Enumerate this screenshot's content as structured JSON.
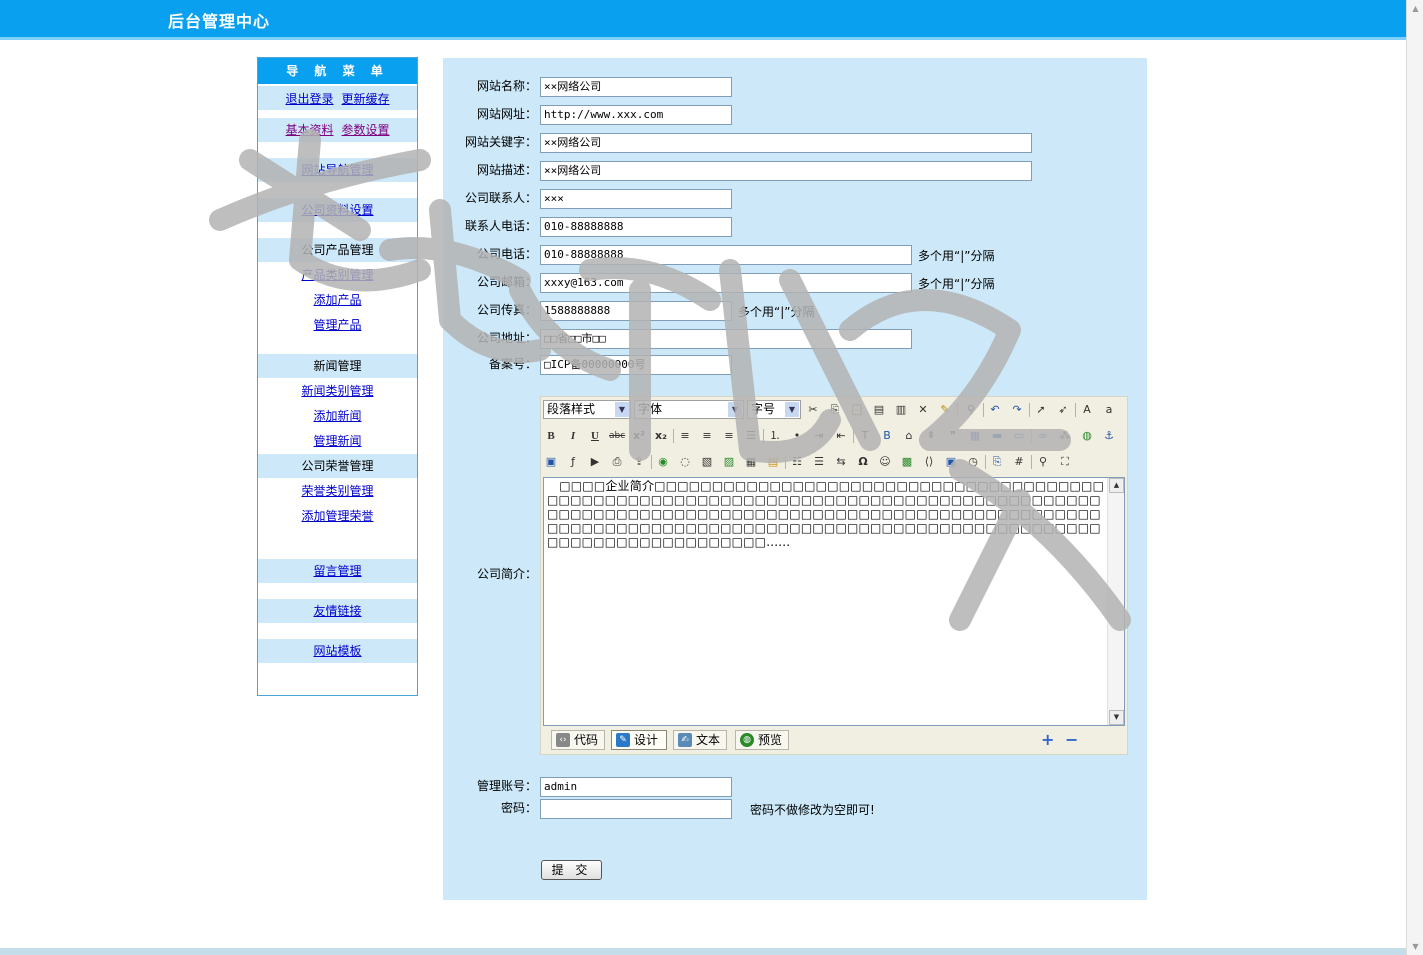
{
  "header": {
    "title": "后台管理中心"
  },
  "sidebar": {
    "heading": "导 航 菜 单",
    "logout": "退出登录",
    "refresh_cache": "更新缓存",
    "basic_info": "基本资料",
    "params": "参数设置",
    "site_nav": "网站导航管理",
    "company_info": "公司资料设置",
    "product_section": "公司产品管理",
    "product_category": "产品类别管理",
    "add_product": "添加产品",
    "manage_product": "管理产品",
    "news_section": "新闻管理",
    "news_category": "新闻类别管理",
    "add_news": "添加新闻",
    "manage_news": "管理新闻",
    "honor_section": "公司荣誉管理",
    "honor_category": "荣誉类别管理",
    "add_honor": "添加管理荣誉",
    "guestbook": "留言管理",
    "links": "友情链接",
    "template": "网站模板"
  },
  "form": {
    "site_name": {
      "label": "网站名称：",
      "value": "××网络公司"
    },
    "site_url": {
      "label": "网站网址：",
      "value": "http://www.xxx.com"
    },
    "keywords": {
      "label": "网站关键字：",
      "value": "××网络公司"
    },
    "description": {
      "label": "网站描述：",
      "value": "××网络公司"
    },
    "contact": {
      "label": "公司联系人：",
      "value": "×××"
    },
    "contact_phone": {
      "label": "联系人电话：",
      "value": "010-88888888"
    },
    "company_phone": {
      "label": "公司电话：",
      "value": "010-88888888",
      "hint": "多个用“|”分隔"
    },
    "company_email": {
      "label": "公司邮箱：",
      "value": "xxxy@163.com",
      "hint": "多个用“|”分隔"
    },
    "company_fax": {
      "label": "公司传真：",
      "value": "1588888888",
      "hint": "多个用“|”分隔"
    },
    "company_address": {
      "label": "公司地址：",
      "value": "□□省□□市□□"
    },
    "icp": {
      "label": "备案号：",
      "value": "□ICP备00000000号"
    },
    "intro": {
      "label": "公司简介："
    },
    "admin_account": {
      "label": "管理账号：",
      "value": "admin"
    },
    "password": {
      "label": "密码：",
      "value": "",
      "hint": "密码不做修改为空即可!"
    },
    "submit": "提 交"
  },
  "editor": {
    "paragraph_style": "段落样式",
    "font_name": "字体",
    "font_size": "字号",
    "content": "　□□□□企业简介□□□□□□□□□□□□□□□□□□□□□□□□□□□□□□□□□□□□□□□□□□□□□□□□□□□□□□□□□□□□□□□□□□□□□□□□□□□□□□□□□□□□□□□□□□□□□□□□□□□□□□□□□□□□□□□□□□□□□□□□□□□□□□□□□□□□□□□□□□□□□□□□□□□□□□□□□□□□□□□□□□□□□□□□□□□□□□□□□□□□□□□□□□□□□□□□□□□□□□□□□□......",
    "modes": [
      "代码",
      "设计",
      "文本",
      "预览"
    ]
  },
  "watermark": "老猫树网络",
  "colors": {
    "header_bg": "#0aa0f0",
    "panel_bg": "#cde9f9",
    "section_band": "#cde8f8",
    "link": "#0000cc"
  }
}
